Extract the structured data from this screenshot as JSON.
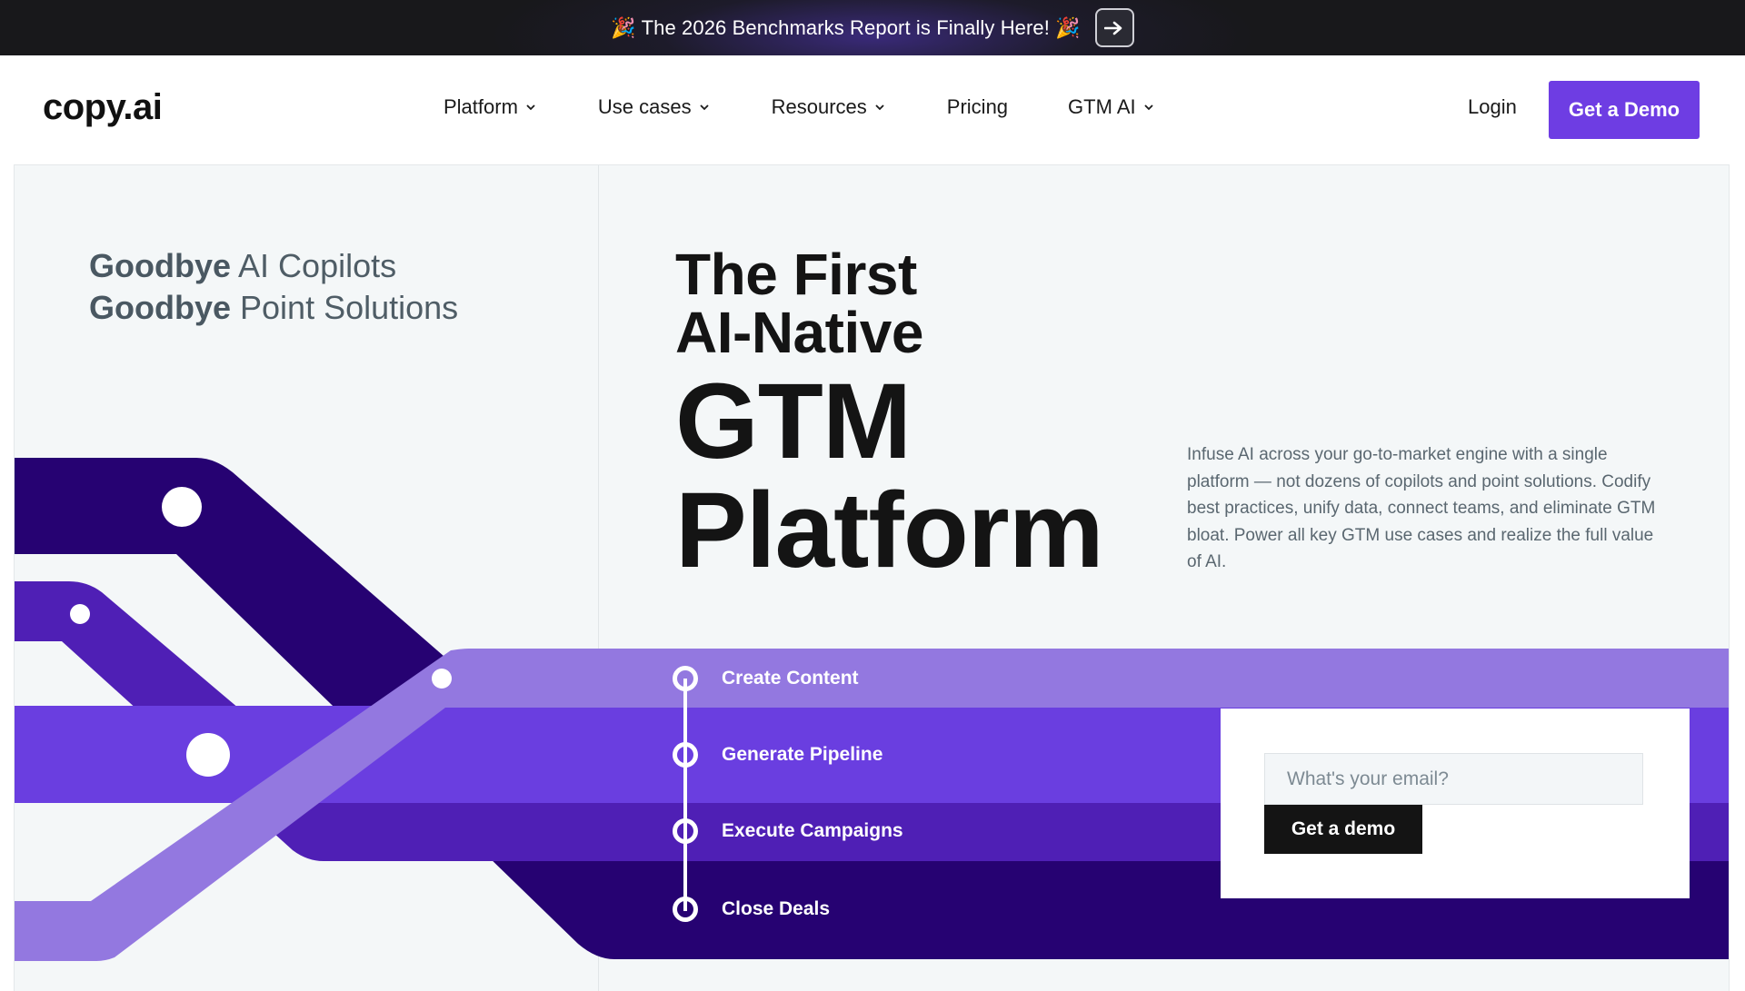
{
  "announcement": {
    "text": "🎉 The 2026 Benchmarks Report is Finally Here! 🎉",
    "arrow_icon": "arrow-right-icon"
  },
  "nav": {
    "logo": "copy.ai",
    "menu": [
      {
        "label": "Platform",
        "has_dropdown": true
      },
      {
        "label": "Use cases",
        "has_dropdown": true
      },
      {
        "label": "Resources",
        "has_dropdown": true
      },
      {
        "label": "Pricing",
        "has_dropdown": false
      },
      {
        "label": "GTM AI",
        "has_dropdown": true
      }
    ],
    "login": "Login",
    "cta": "Get a Demo"
  },
  "hero": {
    "goodbye_1_bold": "Goodbye",
    "goodbye_1_rest": " AI Copilots",
    "goodbye_2_bold": "Goodbye",
    "goodbye_2_rest": " Point Solutions",
    "headline_1": "The First",
    "headline_2": "AI-Native",
    "headline_3": "GTM",
    "headline_4": "Platform",
    "description": "Infuse AI across your go-to-market engine with a single platform — not dozens of copilots and point solutions. Codify best practices, unify data, connect teams, and eliminate GTM bloat. Power all key GTM use cases and realize the full value of AI.",
    "steps": [
      "Create Content",
      "Generate Pipeline",
      "Execute Campaigns",
      "Close Deals"
    ],
    "form": {
      "email_placeholder": "What's your email?",
      "button": "Get a demo"
    }
  },
  "colors": {
    "accent": "#6e3de3",
    "band_light": "#9378e0",
    "band_mid": "#6a3ee0",
    "band_deep": "#4f1fb5",
    "band_dark": "#260272",
    "hero_bg": "#f4f7f8"
  }
}
